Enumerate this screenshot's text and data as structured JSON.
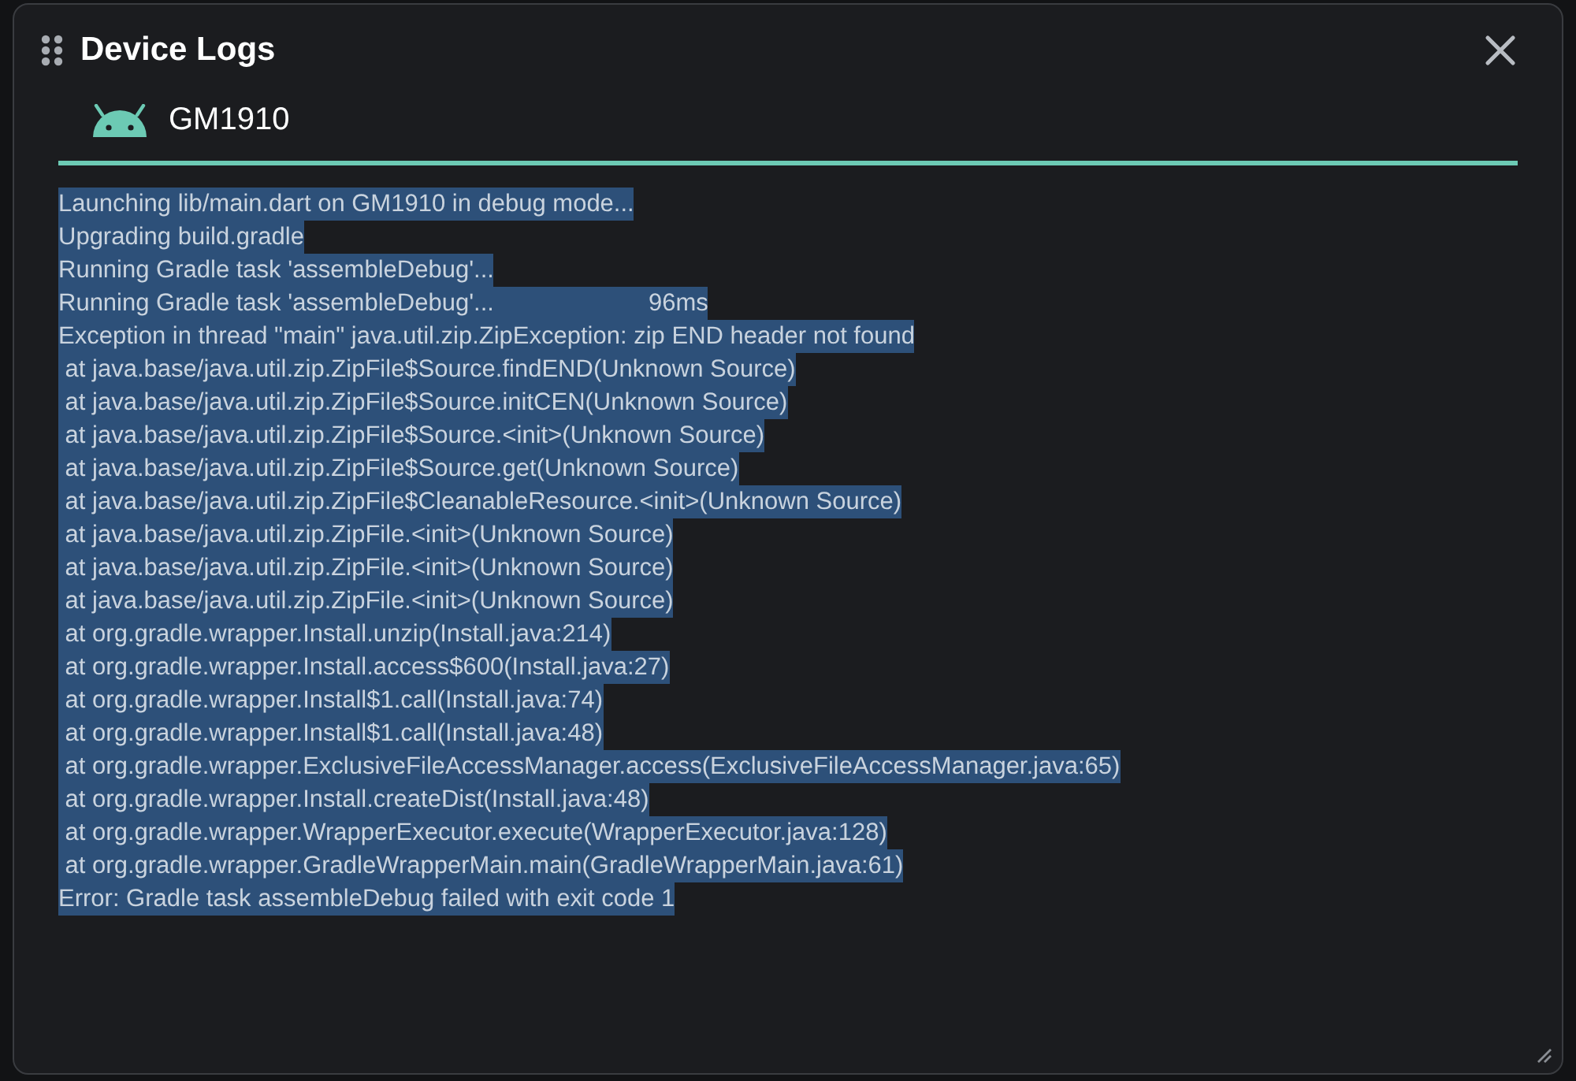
{
  "dialog": {
    "title": "Device Logs"
  },
  "tabs": [
    {
      "label": "GM1910",
      "selected": true
    }
  ],
  "log_lines": [
    {
      "text": "Launching lib/main.dart on GM1910 in debug mode...",
      "selected": true
    },
    {
      "text": "Upgrading build.gradle",
      "selected": true
    },
    {
      "text": "Running Gradle task 'assembleDebug'...",
      "selected": true
    },
    {
      "text": "Running Gradle task 'assembleDebug'...",
      "time": "96ms",
      "selected": true
    },
    {
      "text": "Exception in thread \"main\" java.util.zip.ZipException: zip END header not found",
      "selected": true
    },
    {
      "text": " at java.base/java.util.zip.ZipFile$Source.findEND(Unknown Source)",
      "selected": true
    },
    {
      "text": " at java.base/java.util.zip.ZipFile$Source.initCEN(Unknown Source)",
      "selected": true
    },
    {
      "text": " at java.base/java.util.zip.ZipFile$Source.<init>(Unknown Source)",
      "selected": true
    },
    {
      "text": " at java.base/java.util.zip.ZipFile$Source.get(Unknown Source)",
      "selected": true
    },
    {
      "text": " at java.base/java.util.zip.ZipFile$CleanableResource.<init>(Unknown Source)",
      "selected": true
    },
    {
      "text": " at java.base/java.util.zip.ZipFile.<init>(Unknown Source)",
      "selected": true
    },
    {
      "text": " at java.base/java.util.zip.ZipFile.<init>(Unknown Source)",
      "selected": true
    },
    {
      "text": " at java.base/java.util.zip.ZipFile.<init>(Unknown Source)",
      "selected": true
    },
    {
      "text": " at org.gradle.wrapper.Install.unzip(Install.java:214)",
      "selected": true
    },
    {
      "text": " at org.gradle.wrapper.Install.access$600(Install.java:27)",
      "selected": true
    },
    {
      "text": " at org.gradle.wrapper.Install$1.call(Install.java:74)",
      "selected": true
    },
    {
      "text": " at org.gradle.wrapper.Install$1.call(Install.java:48)",
      "selected": true
    },
    {
      "text": " at org.gradle.wrapper.ExclusiveFileAccessManager.access(ExclusiveFileAccessManager.java:65)",
      "selected": true
    },
    {
      "text": " at org.gradle.wrapper.Install.createDist(Install.java:48)",
      "selected": true
    },
    {
      "text": " at org.gradle.wrapper.WrapperExecutor.execute(WrapperExecutor.java:128)",
      "selected": true
    },
    {
      "text": " at org.gradle.wrapper.GradleWrapperMain.main(GradleWrapperMain.java:61)",
      "selected": true
    },
    {
      "text": "Error: Gradle task assembleDebug failed with exit code 1",
      "selected": true
    }
  ]
}
